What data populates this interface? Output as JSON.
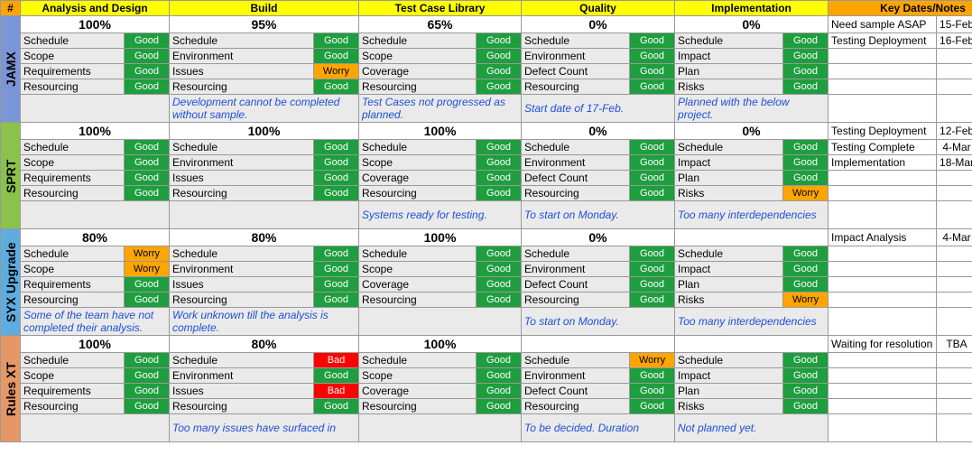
{
  "headers": {
    "hash": "#",
    "stages": [
      "Analysis and Design",
      "Build",
      "Test Case Library",
      "Quality",
      "Implementation"
    ],
    "notes": "Key Dates/Notes"
  },
  "stage_rows": [
    [
      "Schedule",
      "Schedule",
      "Schedule",
      "Schedule",
      "Schedule"
    ],
    [
      "Scope",
      "Environment",
      "Scope",
      "Environment",
      "Impact"
    ],
    [
      "Requirements",
      "Issues",
      "Coverage",
      "Defect Count",
      "Plan"
    ],
    [
      "Resourcing",
      "Resourcing",
      "Resourcing",
      "Resourcing",
      "Risks"
    ]
  ],
  "projects": [
    {
      "id": "JAMX",
      "color": "proj-jamx",
      "pct": [
        "100%",
        "95%",
        "65%",
        "0%",
        "0%"
      ],
      "status": [
        [
          "Good",
          "Good",
          "Good",
          "Good",
          "Good"
        ],
        [
          "Good",
          "Good",
          "Good",
          "Good",
          "Good"
        ],
        [
          "Good",
          "Worry",
          "Good",
          "Good",
          "Good"
        ],
        [
          "Good",
          "Good",
          "Good",
          "Good",
          "Good"
        ]
      ],
      "comments": [
        "",
        "Development cannot be completed without sample.",
        "Test Cases not progressed as planned.",
        "Start date of 17-Feb.",
        "Planned with the below project."
      ],
      "notes": [
        {
          "label": "Need sample ASAP",
          "date": "15-Feb",
          "rag": "Amber"
        },
        {
          "label": "Testing Deployment",
          "date": "16-Feb",
          "rag": "Amber"
        },
        {
          "label": "",
          "date": "",
          "rag": ""
        },
        {
          "label": "",
          "date": "",
          "rag": ""
        },
        {
          "label": "",
          "date": "",
          "rag": ""
        },
        {
          "label": "",
          "date": "",
          "rag": ""
        }
      ]
    },
    {
      "id": "SPRT",
      "color": "proj-sprt",
      "pct": [
        "100%",
        "100%",
        "100%",
        "0%",
        "0%"
      ],
      "status": [
        [
          "Good",
          "Good",
          "Good",
          "Good",
          "Good"
        ],
        [
          "Good",
          "Good",
          "Good",
          "Good",
          "Good"
        ],
        [
          "Good",
          "Good",
          "Good",
          "Good",
          "Good"
        ],
        [
          "Good",
          "Good",
          "Good",
          "Good",
          "Worry"
        ]
      ],
      "comments": [
        "",
        "",
        "Systems ready for testing.",
        "To start on Monday.",
        "Too many interdependencies"
      ],
      "notes": [
        {
          "label": "Testing Deployment",
          "date": "12-Feb",
          "rag": "Green"
        },
        {
          "label": "Testing Complete",
          "date": "4-Mar",
          "rag": "Green"
        },
        {
          "label": "Implementation",
          "date": "18-Mar",
          "rag": "Green"
        },
        {
          "label": "",
          "date": "",
          "rag": ""
        },
        {
          "label": "",
          "date": "",
          "rag": ""
        },
        {
          "label": "",
          "date": "",
          "rag": ""
        }
      ]
    },
    {
      "id": "SYX Upgrade",
      "color": "proj-syx",
      "pct": [
        "80%",
        "80%",
        "100%",
        "0%",
        ""
      ],
      "status": [
        [
          "Worry",
          "Good",
          "Good",
          "Good",
          "Good"
        ],
        [
          "Worry",
          "Good",
          "Good",
          "Good",
          "Good"
        ],
        [
          "Good",
          "Good",
          "Good",
          "Good",
          "Good"
        ],
        [
          "Good",
          "Good",
          "Good",
          "Good",
          "Worry"
        ]
      ],
      "comments": [
        "Some of the team have not completed their analysis.",
        "Work unknown till the analysis is complete.",
        "",
        "To start on Monday.",
        "Too many interdependencies"
      ],
      "notes": [
        {
          "label": "Impact Analysis",
          "date": "4-Mar",
          "rag": "Amber"
        },
        {
          "label": "",
          "date": "",
          "rag": ""
        },
        {
          "label": "",
          "date": "",
          "rag": ""
        },
        {
          "label": "",
          "date": "",
          "rag": ""
        },
        {
          "label": "",
          "date": "",
          "rag": ""
        },
        {
          "label": "",
          "date": "",
          "rag": ""
        }
      ]
    },
    {
      "id": "Rules XT",
      "color": "proj-rules",
      "pct": [
        "100%",
        "80%",
        "100%",
        "",
        ""
      ],
      "status": [
        [
          "Good",
          "Bad",
          "Good",
          "Worry",
          "Good"
        ],
        [
          "Good",
          "Good",
          "Good",
          "Good",
          "Good"
        ],
        [
          "Good",
          "Bad",
          "Good",
          "Good",
          "Good"
        ],
        [
          "Good",
          "Good",
          "Good",
          "Good",
          "Good"
        ]
      ],
      "comments": [
        "",
        "Too many issues have surfaced in",
        "",
        "To be decided. Duration",
        "Not planned yet."
      ],
      "notes": [
        {
          "label": "Waiting for resolution",
          "date": "TBA",
          "rag": "Red"
        },
        {
          "label": "",
          "date": "",
          "rag": ""
        },
        {
          "label": "",
          "date": "",
          "rag": ""
        },
        {
          "label": "",
          "date": "",
          "rag": ""
        },
        {
          "label": "",
          "date": "",
          "rag": ""
        },
        {
          "label": "",
          "date": "",
          "rag": ""
        }
      ]
    }
  ]
}
